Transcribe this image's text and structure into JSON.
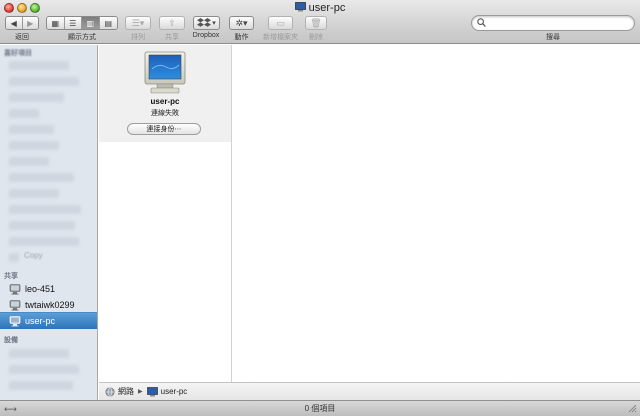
{
  "window": {
    "title": "user-pc"
  },
  "toolbar": {
    "back_label": "返回",
    "view_label": "顯示方式",
    "arrange_label": "排列",
    "share_label": "共享",
    "dropbox_label": "Dropbox",
    "action_label": "動作",
    "new_folder_label": "新增檔案夾",
    "delete_label": "刪除",
    "search_label": "搜尋",
    "search_placeholder": ""
  },
  "sidebar": {
    "favorites_header": "喜好項目",
    "blurred_copy": "Copy",
    "shared_header": "共享",
    "shared_items": [
      {
        "label": "leo-451"
      },
      {
        "label": "twtaiwk0299"
      },
      {
        "label": "user-pc"
      }
    ],
    "devices_header": "設備"
  },
  "column": {
    "computer_name": "user-pc",
    "status": "連線失敗",
    "connect_button": "連接身份⋯"
  },
  "pathbar": {
    "items": [
      "網路",
      "user-pc"
    ]
  },
  "statusbar": {
    "text": "0 個項目"
  },
  "colors": {
    "selection": "#3b82c4",
    "sidebar_bg": "#e0e6ee"
  }
}
